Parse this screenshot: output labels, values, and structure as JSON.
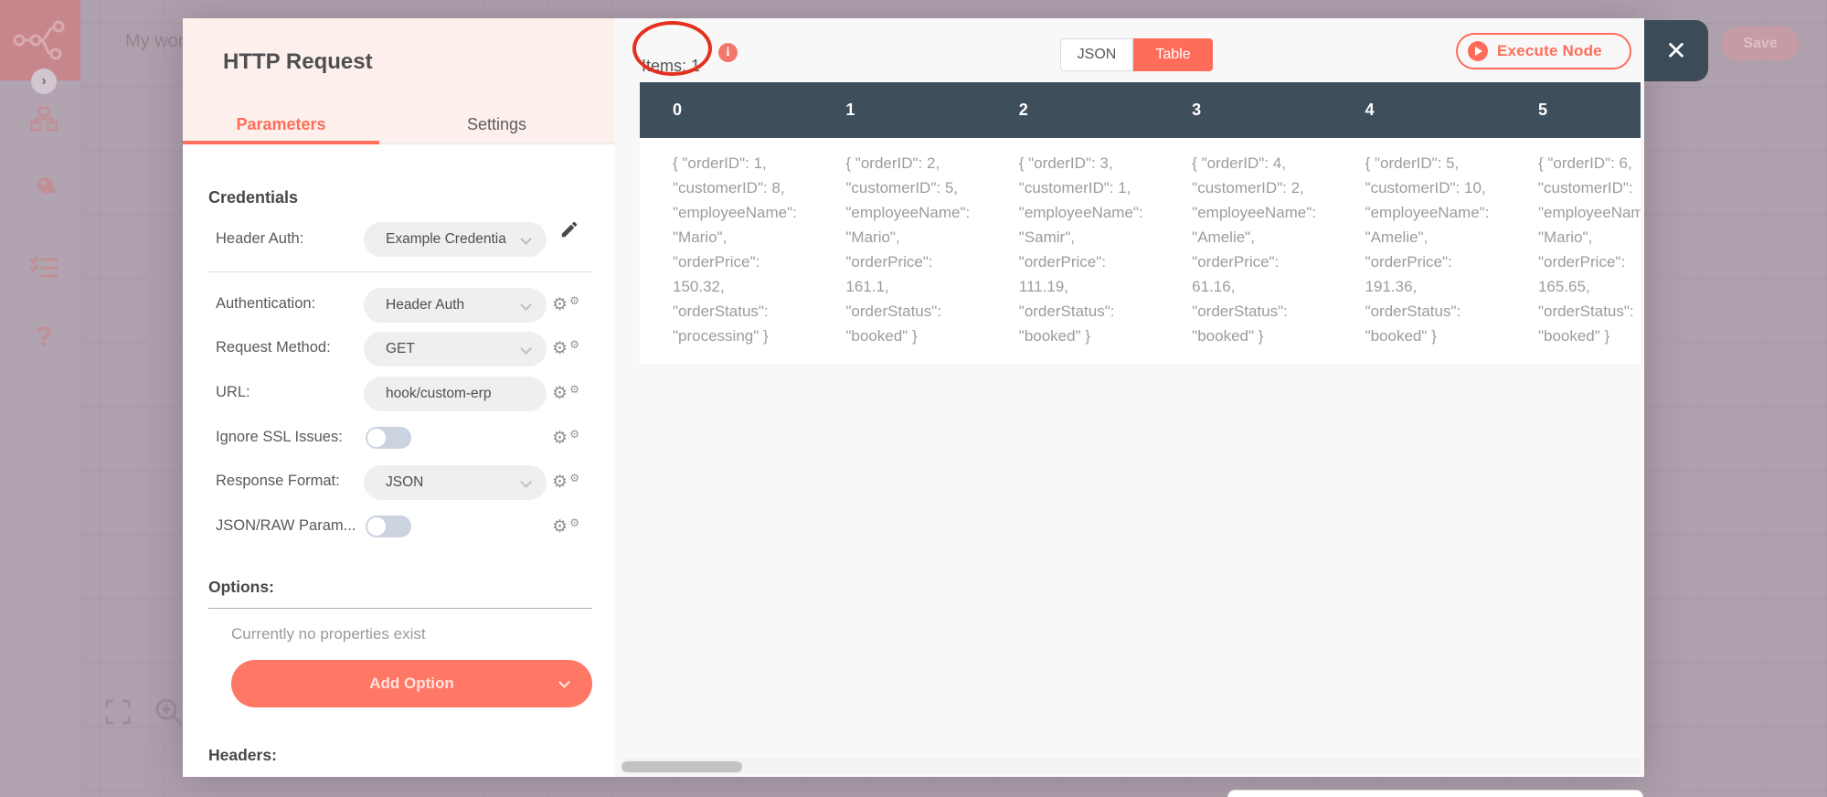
{
  "canvas": {
    "workflow_title": "My workflow"
  },
  "window": {
    "save_label": "Save",
    "close_label": "✕"
  },
  "modal": {
    "title": "HTTP Request",
    "tabs": {
      "parameters": "Parameters",
      "settings": "Settings"
    },
    "credentials": {
      "section_label": "Credentials",
      "header_auth_label": "Header Auth:",
      "header_auth_value": "Example Credentia"
    },
    "params": [
      {
        "label": "Authentication:",
        "type": "select",
        "value": "Header Auth"
      },
      {
        "label": "Request Method:",
        "type": "select",
        "value": "GET"
      },
      {
        "label": "URL:",
        "type": "input",
        "value": "hook/custom-erp"
      },
      {
        "label": "Ignore SSL Issues:",
        "type": "toggle",
        "value": "off"
      },
      {
        "label": "Response Format:",
        "type": "select",
        "value": "JSON"
      },
      {
        "label": "JSON/RAW Param...",
        "type": "toggle",
        "value": "off"
      }
    ],
    "options": {
      "section_label": "Options:",
      "empty_text": "Currently no properties exist",
      "add_button_label": "Add Option"
    },
    "headers_section_label": "Headers:"
  },
  "results": {
    "items_label": "Items: 1",
    "view_json_label": "JSON",
    "view_table_label": "Table",
    "active_view": "Table",
    "execute_button_label": "Execute Node",
    "table": {
      "columns": [
        "0",
        "1",
        "2",
        "3",
        "4",
        "5"
      ],
      "cells": [
        [
          "{ \"orderID\": 1,",
          "\"customerID\": 8,",
          "\"employeeName\":",
          "\"Mario\",",
          "\"orderPrice\":",
          "150.32,",
          "\"orderStatus\":",
          "\"processing\" }"
        ],
        [
          "{ \"orderID\": 2,",
          "\"customerID\": 5,",
          "\"employeeName\":",
          "\"Mario\",",
          "\"orderPrice\":",
          "161.1,",
          "\"orderStatus\":",
          "\"booked\" }"
        ],
        [
          "{ \"orderID\": 3,",
          "\"customerID\": 1,",
          "\"employeeName\":",
          "\"Samir\",",
          "\"orderPrice\":",
          "111.19,",
          "\"orderStatus\":",
          "\"booked\" }"
        ],
        [
          "{ \"orderID\": 4,",
          "\"customerID\": 2,",
          "\"employeeName\":",
          "\"Amelie\",",
          "\"orderPrice\":",
          "61.16,",
          "\"orderStatus\":",
          "\"booked\" }"
        ],
        [
          "{ \"orderID\": 5,",
          "\"customerID\": 10,",
          "\"employeeName\":",
          "\"Amelie\",",
          "\"orderPrice\":",
          "191.36,",
          "\"orderStatus\":",
          "\"booked\" }"
        ],
        [
          "{ \"orderID\": 6,",
          "\"customerID\":",
          "\"employeeName\":",
          "\"Mario\",",
          "\"orderPrice\":",
          "165.65,",
          "\"orderStatus\":",
          "\"booked\" }"
        ]
      ]
    }
  },
  "colors": {
    "accent": "#ff6d5a",
    "table_header": "#3f4e5b",
    "annotation_red": "#e5301d",
    "overlay": "#aea0ac",
    "modal_header_bg": "#fdf0ec"
  }
}
